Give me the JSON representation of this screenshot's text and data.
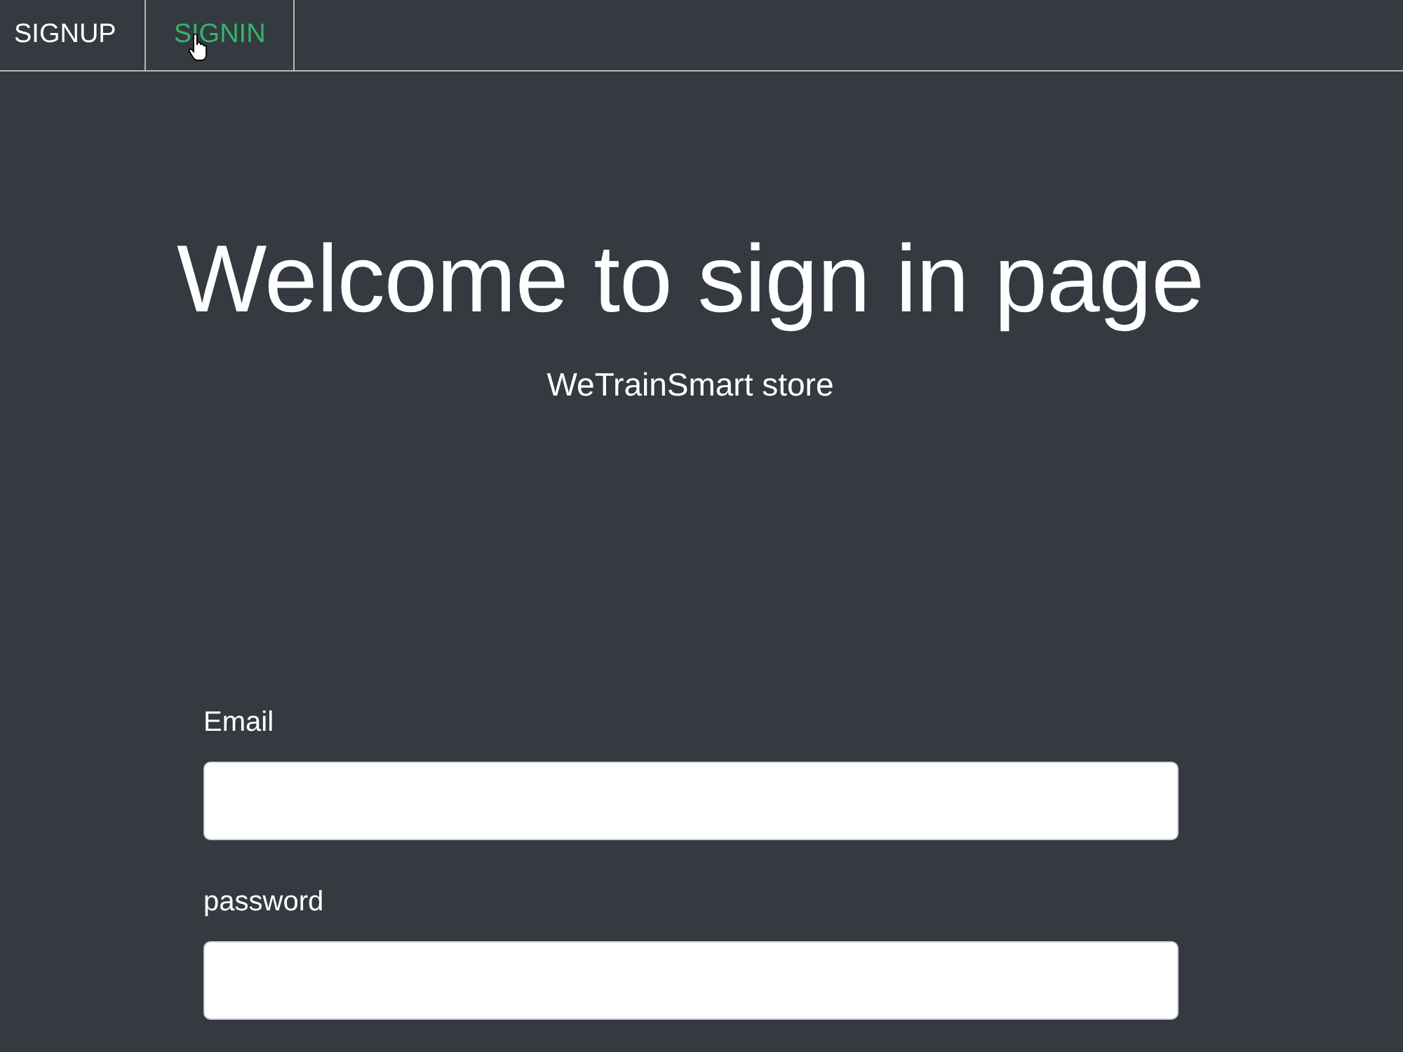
{
  "nav": {
    "tabs": [
      {
        "label": "SIGNUP",
        "selected": false
      },
      {
        "label": "SIGNIN",
        "selected": true
      }
    ]
  },
  "hero": {
    "title": "Welcome to sign in page",
    "subtitle": "WeTrainSmart store"
  },
  "form": {
    "fields": [
      {
        "label": "Email"
      },
      {
        "label": "password"
      }
    ]
  }
}
